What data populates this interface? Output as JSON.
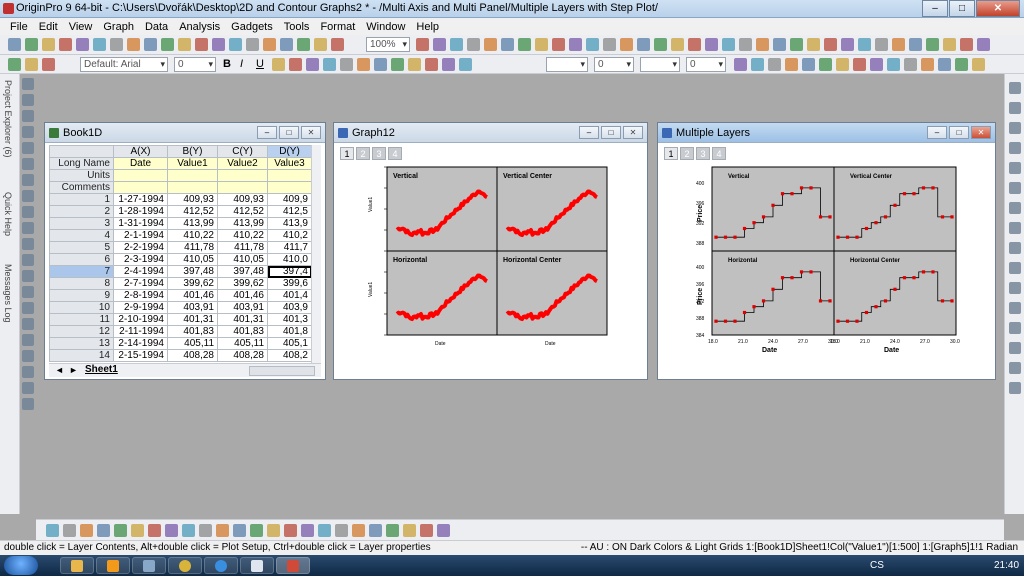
{
  "app": {
    "title": "OriginPro 9 64-bit - C:\\Users\\Dvořák\\Desktop\\2D and Contour Graphs2 * - /Multi Axis and Multi Panel/Multiple Layers with Step Plot/",
    "minimize": "–",
    "maximize": "□",
    "close": "✕"
  },
  "menu": [
    "File",
    "Edit",
    "View",
    "Graph",
    "Data",
    "Analysis",
    "Gadgets",
    "Tools",
    "Format",
    "Window",
    "Help"
  ],
  "toolbar": {
    "zoom": "100%",
    "font_name": "Default: Arial",
    "font_size": "0",
    "line_width": "0",
    "fill_width": "0",
    "bold": "B",
    "italic": "I",
    "underline": "U"
  },
  "side_labels": {
    "project_explorer": "Project Explorer (6)",
    "quick_help": "Quick Help",
    "messages_log": "Messages Log"
  },
  "book": {
    "title": "Book1D",
    "columns": [
      "A(X)",
      "B(Y)",
      "C(Y)",
      "D(Y)"
    ],
    "long_name_label": "Long Name",
    "units_label": "Units",
    "comments_label": "Comments",
    "long_names": [
      "Date",
      "Value1",
      "Value2",
      "Value3"
    ],
    "rows": [
      [
        "1",
        "1-27-1994",
        "409,93",
        "409,93",
        "409,9"
      ],
      [
        "2",
        "1-28-1994",
        "412,52",
        "412,52",
        "412,5"
      ],
      [
        "3",
        "1-31-1994",
        "413,99",
        "413,99",
        "413,9"
      ],
      [
        "4",
        "2-1-1994",
        "410,22",
        "410,22",
        "410,2"
      ],
      [
        "5",
        "2-2-1994",
        "411,78",
        "411,78",
        "411,7"
      ],
      [
        "6",
        "2-3-1994",
        "410,05",
        "410,05",
        "410,0"
      ],
      [
        "7",
        "2-4-1994",
        "397,48",
        "397,48",
        "397,4"
      ],
      [
        "8",
        "2-7-1994",
        "399,62",
        "399,62",
        "399,6"
      ],
      [
        "9",
        "2-8-1994",
        "401,46",
        "401,46",
        "401,4"
      ],
      [
        "10",
        "2-9-1994",
        "403,91",
        "403,91",
        "403,9"
      ],
      [
        "11",
        "2-10-1994",
        "401,31",
        "401,31",
        "401,3"
      ],
      [
        "12",
        "2-11-1994",
        "401,83",
        "401,83",
        "401,8"
      ],
      [
        "13",
        "2-14-1994",
        "405,11",
        "405,11",
        "405,1"
      ],
      [
        "14",
        "2-15-1994",
        "408,28",
        "408,28",
        "408,2"
      ]
    ],
    "sheet_tab": "Sheet1"
  },
  "graph12": {
    "title": "Graph12",
    "pages": [
      "1",
      "2",
      "3",
      "4"
    ],
    "panels": [
      "Vertical",
      "Vertical Center",
      "Horizontal",
      "Horizontal Center"
    ],
    "ylabel": "Value1",
    "xlabel": "Date",
    "curve_color": "#ff0000"
  },
  "multi": {
    "title": "Multiple Layers",
    "pages": [
      "1",
      "2",
      "3",
      "4"
    ],
    "panels": [
      "Vertical",
      "Vertical Center",
      "Horizontal",
      "Horizontal Center"
    ],
    "ylabel": "Price",
    "xlabel": "Date",
    "yticks_top": [
      "400",
      "396",
      "392",
      "388"
    ],
    "yticks_bottom": [
      "400",
      "396",
      "392",
      "388",
      "384"
    ],
    "xticks": [
      "18.0",
      "21.0",
      "24.0",
      "27.0",
      "30.0"
    ],
    "step_color": "#000000",
    "marker_color": "#e00000"
  },
  "status": {
    "left": "double click = Layer Contents, Alt+double click = Plot Setup, Ctrl+double click = Layer properties",
    "right": "-- AU : ON  Dark Colors & Light Grids  1:[Book1D]Sheet1!Col(\"Value1\")[1:500]  1:[Graph5]1!1  Radian"
  },
  "taskbar": {
    "lang": "CS",
    "clock": "21:40"
  }
}
